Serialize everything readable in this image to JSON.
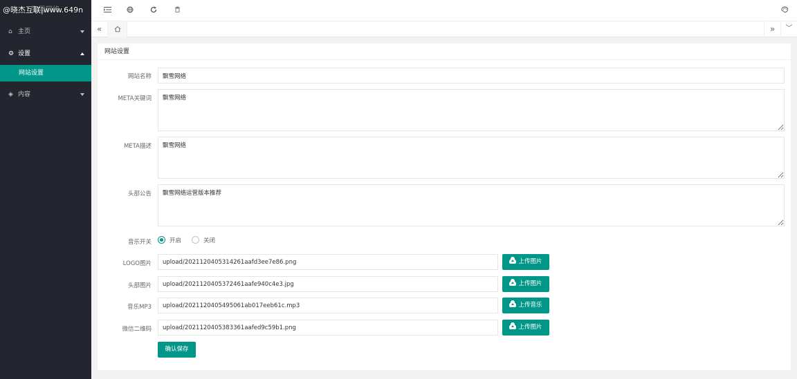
{
  "brand": {
    "watermark": "@晓杰互联|www.649n",
    "logo_text": "飘雪网络"
  },
  "sidebar": {
    "items": [
      {
        "label": "主页",
        "icon": "home-icon"
      },
      {
        "label": "设置",
        "icon": "gear-icon",
        "children": [
          {
            "label": "网站设置"
          }
        ]
      },
      {
        "label": "内容",
        "icon": "diamond-icon"
      }
    ]
  },
  "header": {
    "icons": [
      "menu-toggle-icon",
      "globe-icon",
      "refresh-icon",
      "trash-icon",
      "palette-icon"
    ]
  },
  "tabs": {
    "prev": "«",
    "home_icon": "home-icon",
    "next": "»",
    "more": "﹀"
  },
  "card": {
    "title": "网站设置"
  },
  "form": {
    "site_name": {
      "label": "网站名称",
      "value": "飘雪网络"
    },
    "meta_keywords": {
      "label": "META关键词",
      "value": "飘雪网络"
    },
    "meta_desc": {
      "label": "META描述",
      "value": "飘雪网络"
    },
    "announcement": {
      "label": "头部公告",
      "value": "飘雪网络运营版本推荐"
    },
    "music_switch": {
      "label": "音乐开关",
      "on_label": "开启",
      "off_label": "关闭",
      "selected": "on"
    },
    "logo": {
      "label": "LOGO图片",
      "value": "upload/2021120405314261aafd3ee7e86.png",
      "button": "上传图片"
    },
    "header_img": {
      "label": "头部图片",
      "value": "upload/2021120405372461aafe940c4e3.jpg",
      "button": "上传图片"
    },
    "music_mp3": {
      "label": "音乐MP3",
      "value": "upload/2021120405495061ab017eeb61c.mp3",
      "button": "上传音乐"
    },
    "wechat_qr": {
      "label": "微信二维码",
      "value": "upload/2021120405383361aafed9c59b1.png",
      "button": "上传图片"
    },
    "submit": "确认保存"
  },
  "colors": {
    "sidebar_bg": "#23262e",
    "accent": "#009688",
    "page_bg": "#f2f2f2"
  }
}
